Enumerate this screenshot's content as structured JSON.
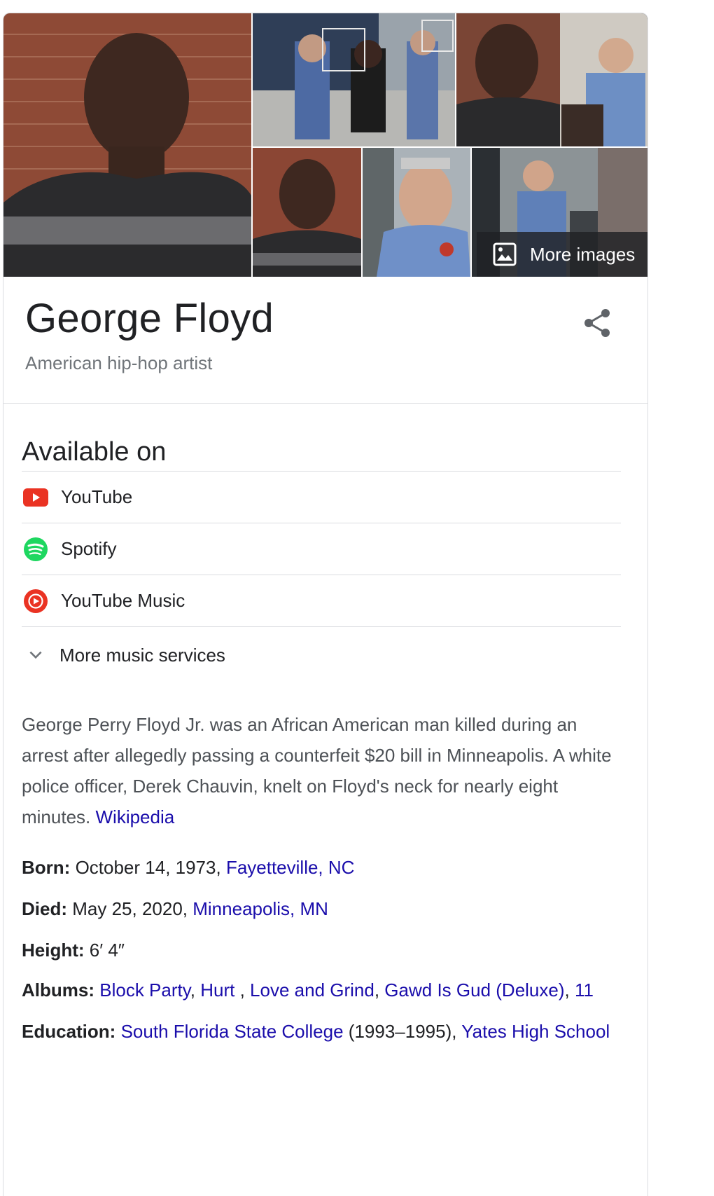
{
  "images": {
    "more_images_label": "More images"
  },
  "entity": {
    "title": "George Floyd",
    "subtitle": "American hip-hop artist"
  },
  "available_on": {
    "heading": "Available on",
    "services": [
      {
        "label": "YouTube",
        "icon": "youtube-icon",
        "color": "#ea3323"
      },
      {
        "label": "Spotify",
        "icon": "spotify-icon",
        "color": "#1ed760"
      },
      {
        "label": "YouTube Music",
        "icon": "youtube-music-icon",
        "color": "#ea3323"
      }
    ],
    "more_label": "More music services"
  },
  "description": {
    "text": "George Perry Floyd Jr. was an African American man killed during an arrest after allegedly passing a counterfeit $20 bill in Minneapolis. A white police officer, Derek Chauvin, knelt on Floyd's neck for nearly eight minutes.",
    "source_link": "Wikipedia"
  },
  "facts": {
    "born": {
      "label": "Born:",
      "value": "October 14, 1973,",
      "link": "Fayetteville, NC"
    },
    "died": {
      "label": "Died:",
      "value": "May 25, 2020,",
      "link": "Minneapolis, MN"
    },
    "height": {
      "label": "Height:",
      "value": "6′ 4″"
    },
    "albums": {
      "label": "Albums:",
      "links": [
        "Block Party",
        "Hurt ",
        "Love and Grind",
        "Gawd Is Gud (Deluxe)",
        "11"
      ],
      "separator": ", "
    },
    "education": {
      "label": "Education:",
      "link1": "South Florida State College",
      "years": "(1993–1995),",
      "link2": "Yates High School"
    }
  },
  "colors": {
    "link": "#1a0dab",
    "text": "#202124",
    "secondary": "#70757a",
    "divider": "#dadce0"
  }
}
